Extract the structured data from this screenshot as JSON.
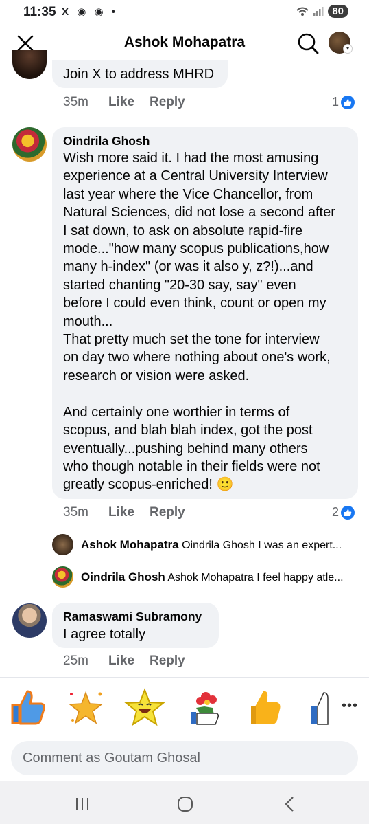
{
  "status": {
    "time": "11:35",
    "left_icons": [
      "X",
      "◉",
      "◉",
      "•"
    ],
    "battery": "80"
  },
  "header": {
    "title": "Ashok Mohapatra"
  },
  "comments": [
    {
      "text": "Join X to address MHRD",
      "time": "35m",
      "like": "Like",
      "reply": "Reply",
      "reaction_count": "1"
    },
    {
      "name": "Oindrila Ghosh",
      "text": "Wish more said it. I had the most amusing\nexperience at a Central University Interview\nlast year where the Vice Chancellor, from\nNatural Sciences, did not lose a second after\nI sat down, to ask on absolute rapid-fire\nmode...\"how many scopus publications,how\nmany h-index\" (or was it also y, z?!)...and\nstarted chanting \"20-30 say, say\" even\nbefore I could even think, count or open my\nmouth...\nThat pretty much set the tone for interview\non day two where nothing about one's work,\nresearch or vision were asked.\n\nAnd certainly one worthier in terms of\nscopus, and blah blah index, got the post\neventually...pushing behind many others\nwho though notable in their fields were not\ngreatly scopus-enriched! 🙂",
      "time": "35m",
      "like": "Like",
      "reply": "Reply",
      "reaction_count": "2"
    },
    {
      "name": "Ramaswami Subramony",
      "text": "I agree totally",
      "time": "25m",
      "like": "Like",
      "reply": "Reply"
    }
  ],
  "replies": [
    {
      "name": "Ashok Mohapatra",
      "preview": "Oindrila Ghosh I was an expert..."
    },
    {
      "name": "Oindrila Ghosh",
      "preview": "Ashok Mohapatra I feel happy atle..."
    }
  ],
  "stickers": [
    "thumbs-up-sticker",
    "sparkle-star-sticker",
    "smiling-star-sticker",
    "flower-thumbs-sticker",
    "yellow-thumbs-sticker",
    "partial-sticker"
  ],
  "composer": {
    "placeholder": "Comment as Goutam Ghosal"
  },
  "colors": {
    "accent": "#1877f2",
    "bubble": "#f0f2f5",
    "meta": "#65676b"
  }
}
